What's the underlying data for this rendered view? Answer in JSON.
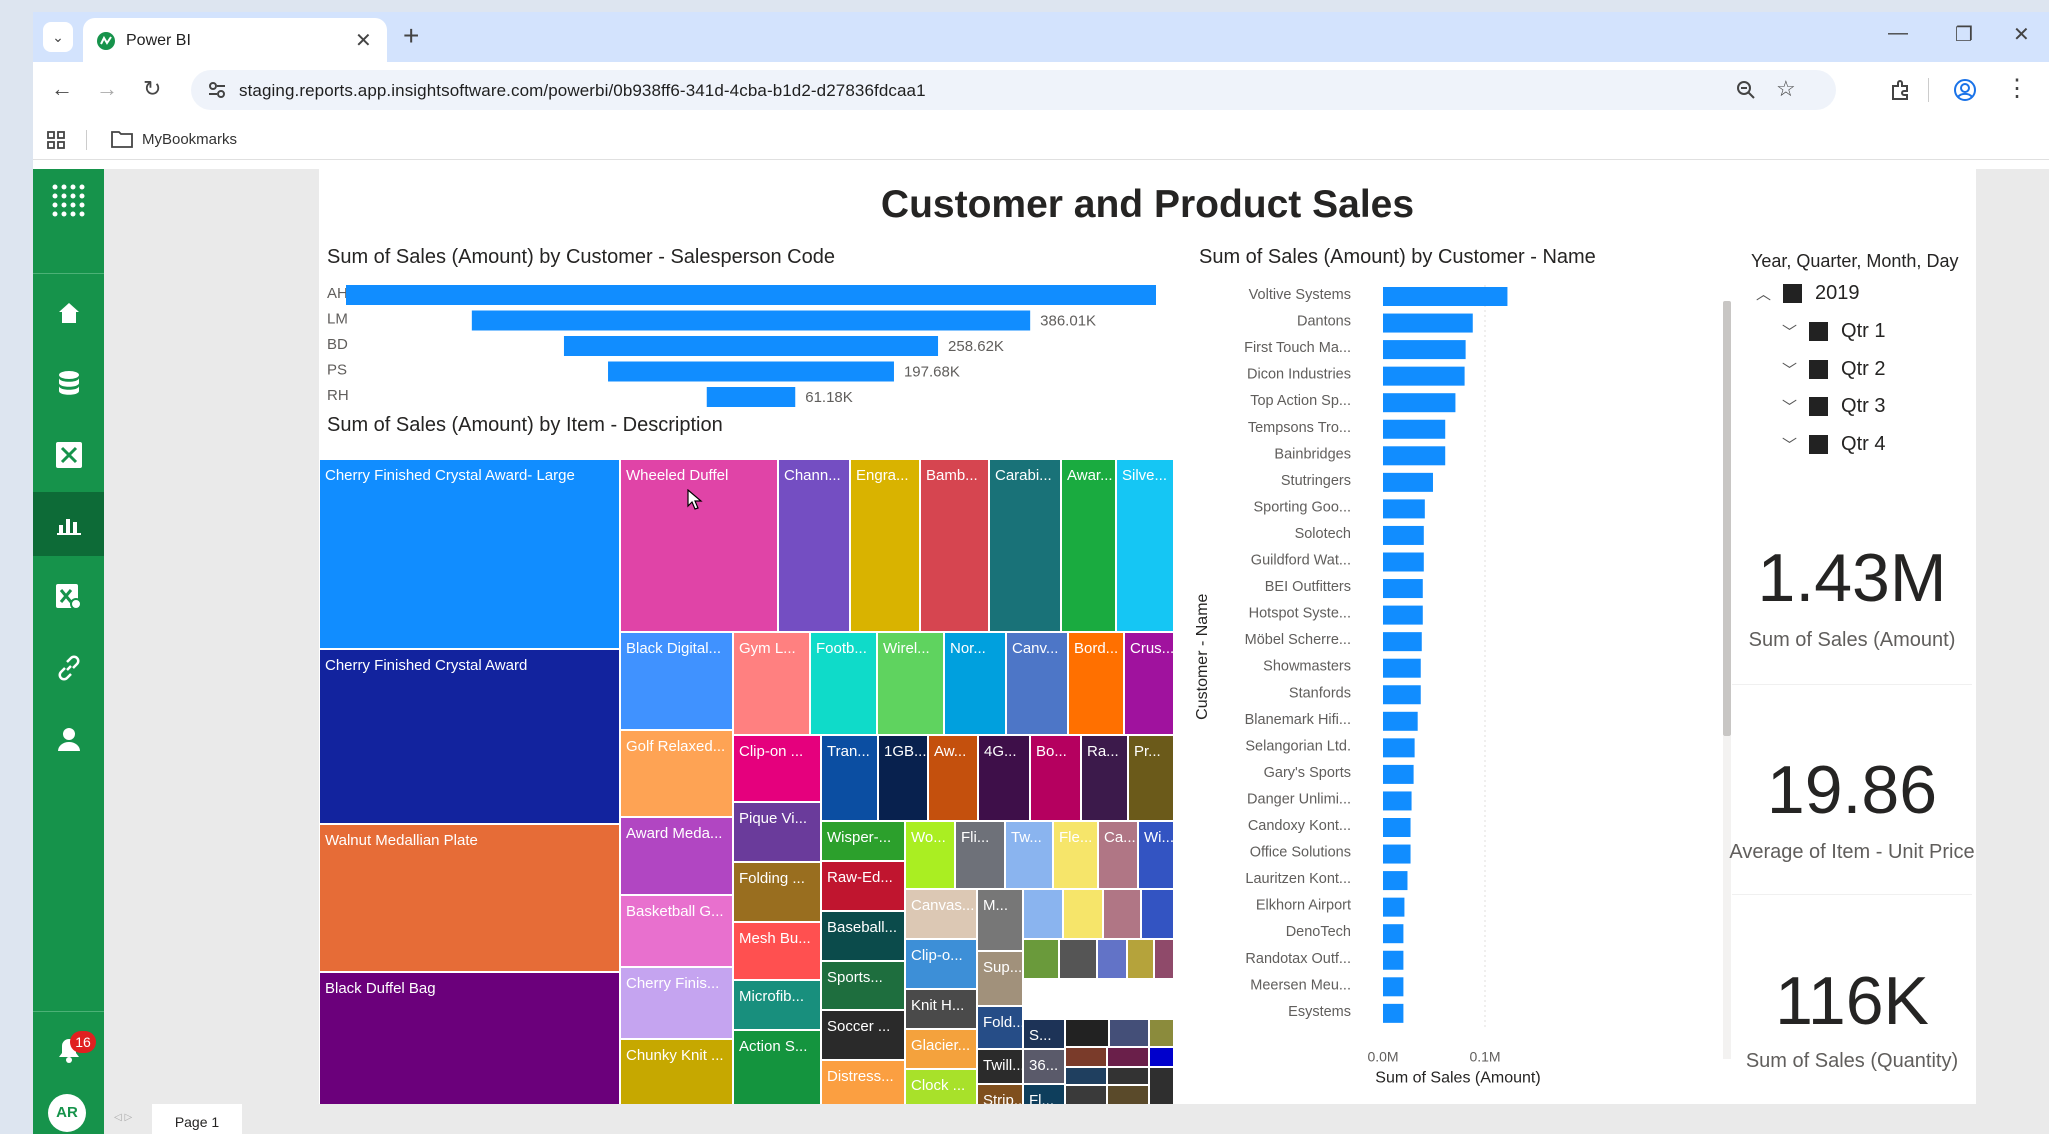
{
  "browser": {
    "tab_title": "Power BI",
    "url": "staging.reports.app.insightsoftware.com/powerbi/0b938ff6-341d-4cba-b1d2-d27836fdcaa1",
    "bookmark_folder": "MyBookmarks"
  },
  "sidebar": {
    "notification_count": "16",
    "avatar_initials": "AR"
  },
  "report": {
    "title": "Customer and Product Sales",
    "page_tab": "Page 1",
    "salesperson_chart_title": "Sum of Sales (Amount) by Customer - Salesperson Code",
    "treemap_title": "Sum of Sales (Amount) by Item - Description",
    "customer_chart_title": "Sum of Sales (Amount) by Customer - Name",
    "slicer": {
      "title": "Year, Quarter, Month, Day",
      "items": [
        "2019",
        "Qtr 1",
        "Qtr 2",
        "Qtr 3",
        "Qtr 4"
      ]
    },
    "cards": [
      {
        "value": "1.43M",
        "label": "Sum of Sales (Amount)"
      },
      {
        "value": "19.86",
        "label": "Average of Item - Unit Price"
      },
      {
        "value": "116K",
        "label": "Sum of Sales (Quantity)"
      }
    ],
    "treemap_labels": [
      "Cherry Finished Crystal Award- Large",
      "Wheeled Duffel",
      "Chann...",
      "Engra...",
      "Bamb...",
      "Carabi...",
      "Awar...",
      "Silve...",
      "Cherry Finished Crystal Award",
      "Black Digital...",
      "Gym L...",
      "Footb...",
      "Wirel...",
      "Nor...",
      "Canv...",
      "Bord...",
      "Crus...",
      "Walnut Medallian Plate",
      "Golf Relaxed...",
      "Clip-on ...",
      "Tran...",
      "1GB...",
      "Aw...",
      "4G...",
      "Bo...",
      "Ra...",
      "Pr...",
      "Black Duffel Bag",
      "Award Meda...",
      "Pique Vi...",
      "Wisper-...",
      "Wo...",
      "Fli...",
      "Tw...",
      "Fle...",
      "Ca...",
      "Wi...",
      "Basketball G...",
      "Folding ...",
      "Raw-Ed...",
      "Canvas...",
      "M...",
      "Cherry Finis...",
      "Mesh Bu...",
      "Baseball...",
      "Clip-o...",
      "Sup...",
      "Microfib...",
      "Sports...",
      "Knit H...",
      "Fold...",
      "S...",
      "Chunky Knit ...",
      "Action S...",
      "Soccer ...",
      "Glacier...",
      "Twill...",
      "36...",
      "Distress...",
      "Clock ...",
      "Strip...",
      "Fl..."
    ]
  },
  "chart_data": [
    {
      "type": "bar",
      "orientation": "horizontal",
      "title": "Sum of Sales (Amount) by Customer - Salesperson Code",
      "categories": [
        "AH",
        "LM",
        "BD",
        "PS",
        "RH"
      ],
      "values": [
        560000,
        386010,
        258620,
        197680,
        61180
      ],
      "data_labels": [
        "",
        "386.01K",
        "258.62K",
        "197.68K",
        "61.18K"
      ]
    },
    {
      "type": "bar",
      "orientation": "horizontal",
      "title": "Sum of Sales (Amount) by Customer - Name",
      "xlabel": "Sum of Sales (Amount)",
      "ylabel": "Customer - Name",
      "x_ticks": [
        "0.0M",
        "0.1M"
      ],
      "xlim": [
        0,
        0.15
      ],
      "categories": [
        "Voltive Systems",
        "Dantons",
        "First Touch Ma...",
        "Dicon Industries",
        "Top Action Sp...",
        "Tempsons Tro...",
        "Bainbridges",
        "Stutringers",
        "Sporting Goo...",
        "Solotech",
        "Guildford Wat...",
        "BEI Outfitters",
        "Hotspot Syste...",
        "Möbel Scherre...",
        "Showmasters",
        "Stanfords",
        "Blanemark Hifi...",
        "Selangorian Ltd.",
        "Gary's Sports",
        "Danger Unlimi...",
        "Candoxy Kont...",
        "Office Solutions",
        "Lauritzen Kont...",
        "Elkhorn Airport",
        "DenoTech",
        "Randotax Outf...",
        "Meersen Meu...",
        "Esystems"
      ],
      "values": [
        0.122,
        0.088,
        0.081,
        0.08,
        0.071,
        0.061,
        0.061,
        0.049,
        0.041,
        0.04,
        0.04,
        0.039,
        0.039,
        0.038,
        0.037,
        0.037,
        0.034,
        0.031,
        0.03,
        0.028,
        0.027,
        0.027,
        0.024,
        0.021,
        0.02,
        0.02,
        0.02,
        0.02
      ]
    }
  ]
}
